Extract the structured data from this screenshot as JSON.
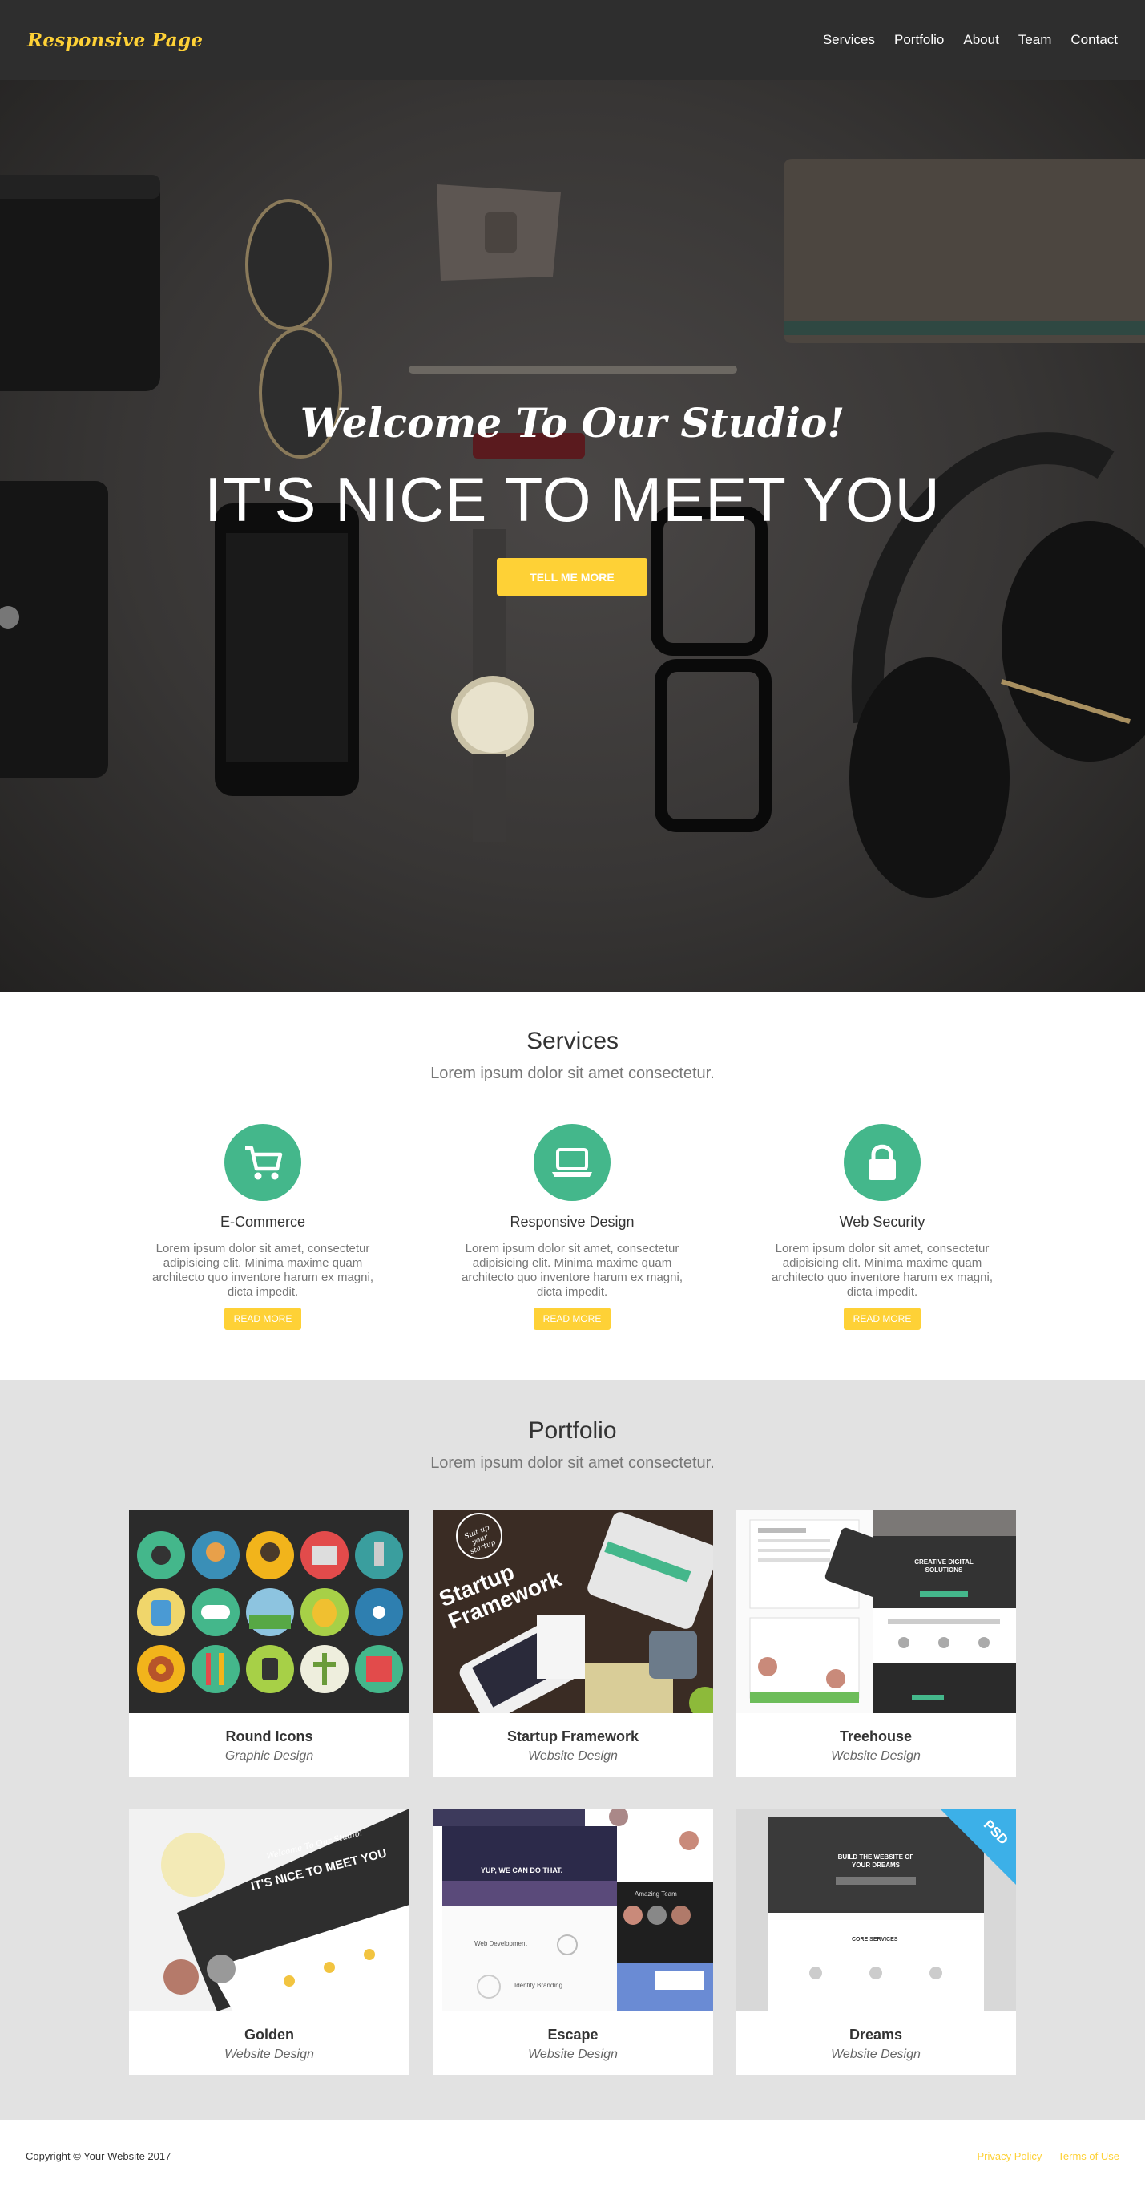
{
  "nav": {
    "brand": "Responsive Page",
    "items": [
      "Services",
      "Portfolio",
      "About",
      "Team",
      "Contact"
    ]
  },
  "hero": {
    "subtitle": "Welcome To Our Studio!",
    "title": "IT'S NICE TO MEET YOU",
    "button": "TELL ME MORE"
  },
  "services": {
    "title": "Services",
    "subtitle": "Lorem ipsum dolor sit amet consectetur.",
    "items": [
      {
        "title": "E-Commerce",
        "text": "Lorem ipsum dolor sit amet, consectetur adipisicing elit. Minima maxime quam architecto quo inventore harum ex magni, dicta impedit.",
        "button": "READ MORE",
        "icon": "shopping-cart-icon"
      },
      {
        "title": "Responsive Design",
        "text": "Lorem ipsum dolor sit amet, consectetur adipisicing elit. Minima maxime quam architecto quo inventore harum ex magni, dicta impedit.",
        "button": "READ MORE",
        "icon": "laptop-icon"
      },
      {
        "title": "Web Security",
        "text": "Lorem ipsum dolor sit amet, consectetur adipisicing elit. Minima maxime quam architecto quo inventore harum ex magni, dicta impedit.",
        "button": "READ MORE",
        "icon": "lock-icon"
      }
    ]
  },
  "portfolio": {
    "title": "Portfolio",
    "subtitle": "Lorem ipsum dolor sit amet consectetur.",
    "items": [
      {
        "title": "Round Icons",
        "category": "Graphic Design"
      },
      {
        "title": "Startup Framework",
        "category": "Website Design"
      },
      {
        "title": "Treehouse",
        "category": "Website Design"
      },
      {
        "title": "Golden",
        "category": "Website Design"
      },
      {
        "title": "Escape",
        "category": "Website Design"
      },
      {
        "title": "Dreams",
        "category": "Website Design"
      }
    ],
    "thumb_text": {
      "startup": "Startup Framework",
      "startup_badge": "Suit up your startup",
      "treehouse_headline": "CREATIVE DIGITAL SOLUTIONS",
      "golden_title": "IT'S NICE TO MEET YOU",
      "golden_sub": "Welcome To Our Studio!",
      "escape_headline": "YUP, WE CAN DO THAT.",
      "escape_team": "Amazing Team",
      "escape_dev": "Web Development",
      "escape_brand": "Identity Branding",
      "dreams_headline": "BUILD THE WEBSITE OF YOUR DREAMS",
      "dreams_services": "CORE SERVICES",
      "dreams_ribbon": "PSD"
    }
  },
  "footer": {
    "copyright": "Copyright © Your Website 2017",
    "links": [
      "Privacy Policy",
      "Terms of Use"
    ]
  },
  "colors": {
    "accent": "#fed136",
    "teal": "#44b78b",
    "nav_bg": "#2e2e2e",
    "portfolio_bg": "#e2e2e2"
  }
}
